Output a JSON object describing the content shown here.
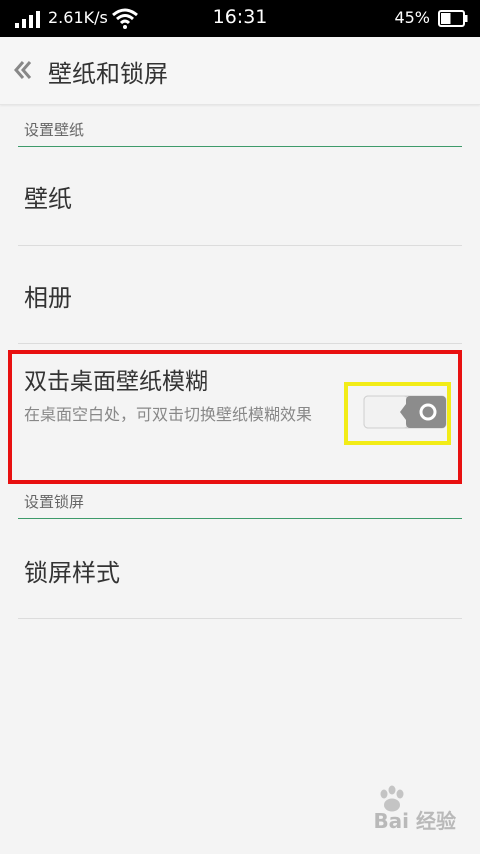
{
  "status_bar": {
    "speed": "2.61K/s",
    "time": "16:31",
    "battery": "45%",
    "battery_level": 0.45
  },
  "header": {
    "title": "壁纸和锁屏"
  },
  "sections": [
    {
      "title": "设置壁纸",
      "items": [
        {
          "label": "壁纸"
        },
        {
          "label": "相册"
        },
        {
          "label": "双击桌面壁纸模糊",
          "description": "在桌面空白处，可双击切换壁纸模糊效果",
          "toggle_on": false
        }
      ]
    },
    {
      "title": "设置锁屏",
      "items": [
        {
          "label": "锁屏样式"
        }
      ]
    }
  ],
  "watermark": "Bai 经验",
  "colors": {
    "accent_line": "#3d9a6a",
    "highlight_red": "#e81010",
    "highlight_yellow": "#f2ec17"
  }
}
